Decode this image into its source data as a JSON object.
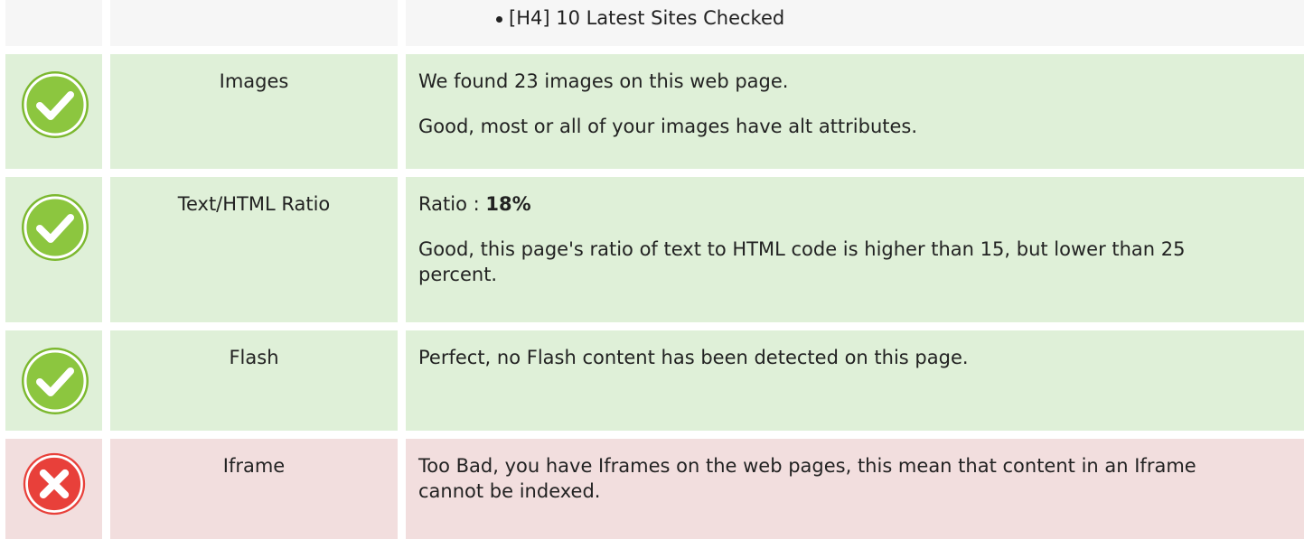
{
  "headings_tail": {
    "items": [
      "[H4] 10 Latest Sites Checked"
    ]
  },
  "rows": [
    {
      "status": "good",
      "icon": "check-icon",
      "label": "Images",
      "desc_1": "We found 23 images on this web page.",
      "desc_2": "Good, most or all of your images have alt attributes."
    },
    {
      "status": "good",
      "icon": "check-icon",
      "label": "Text/HTML Ratio",
      "desc_prefix": "Ratio : ",
      "desc_value": "18%",
      "desc_2": "Good, this page's ratio of text to HTML code is higher than 15, but lower than 25 percent."
    },
    {
      "status": "good",
      "icon": "check-icon",
      "label": "Flash",
      "desc_1": "Perfect, no Flash content has been detected on this page."
    },
    {
      "status": "bad",
      "icon": "error-x-icon",
      "label": "Iframe",
      "desc_1": "Too Bad, you have Iframes on the web pages, this mean that content in an Iframe cannot be indexed."
    }
  ],
  "colors": {
    "good_bg": "#dff0d8",
    "bad_bg": "#f2dede",
    "neutral_bg": "#f6f6f6",
    "check_green": "#8cc63f",
    "error_red": "#e8403a"
  }
}
